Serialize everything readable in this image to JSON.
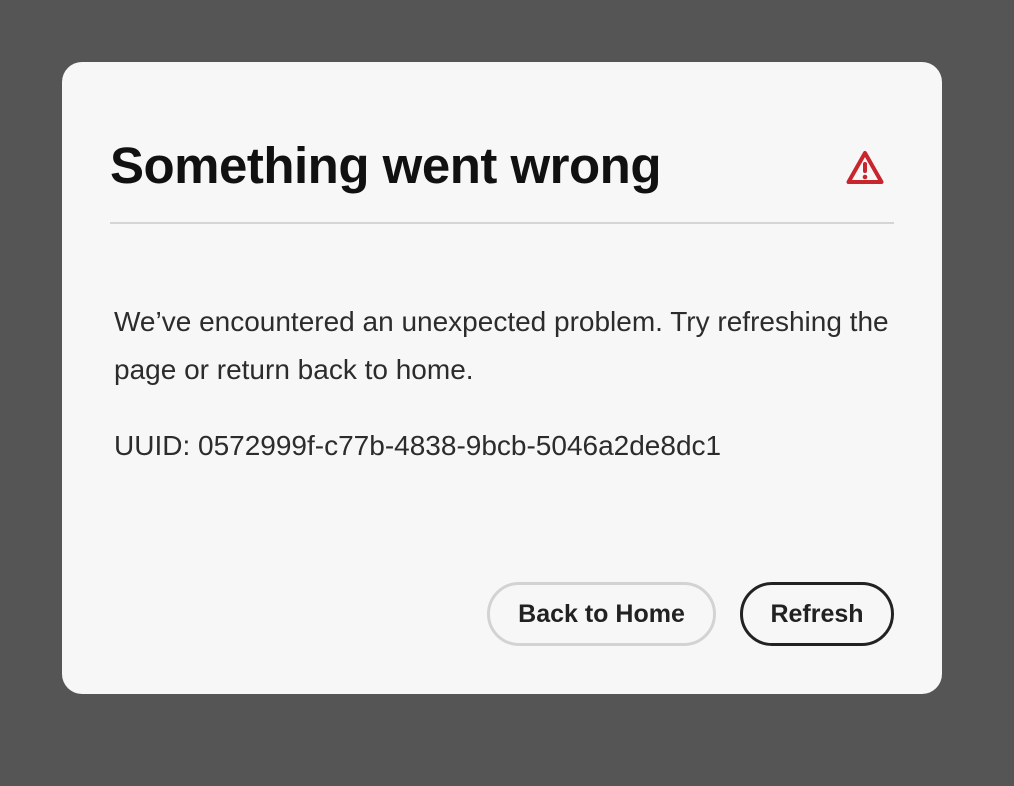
{
  "dialog": {
    "title": "Something went wrong",
    "icon": "alert-triangle-icon",
    "icon_color": "#c9252d",
    "message": "We’ve encountered an unexpected problem. Try refreshing the page or return back to home.",
    "uuid": "UUID: 0572999f-c77b-4838-9bcb-5046a2de8dc1",
    "buttons": {
      "back_home_label": "Back to Home",
      "refresh_label": "Refresh"
    }
  },
  "colors": {
    "backdrop": "#555555",
    "dialog_bg": "#f7f7f7",
    "primary_border": "#222222",
    "secondary_border": "#d3d3d3"
  }
}
